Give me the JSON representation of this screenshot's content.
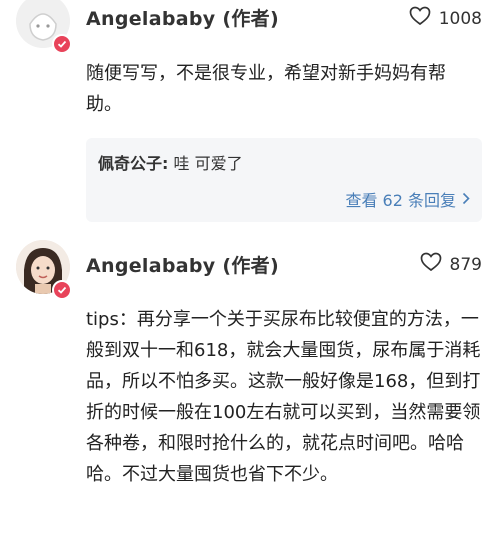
{
  "comments": [
    {
      "author": "Angelababy (作者)",
      "likes": "1008",
      "text": "随便写写，不是很专业，希望对新手妈妈有帮助。",
      "reply": {
        "author": "佩奇公子:",
        "text": " 哇 可爱了",
        "more": "查看 62 条回复"
      }
    },
    {
      "author": "Angelababy (作者)",
      "likes": "879",
      "text": "tips：再分享一个关于买尿布比较便宜的方法，一般到双十一和618，就会大量囤货，尿布属于消耗品，所以不怕多买。这款一般好像是168，但到打折的时候一般在100左右就可以买到，当然需要领各种卷，和限时抢什么的，就花点时间吧。哈哈哈。不过大量囤货也省下不少。"
    }
  ],
  "colors": {
    "badge": "#e8435a",
    "link": "#4a7fb8",
    "reply_bg": "#f5f6f8"
  },
  "icons": [
    "heart-icon",
    "chevron-right-icon",
    "verified-badge-icon"
  ]
}
